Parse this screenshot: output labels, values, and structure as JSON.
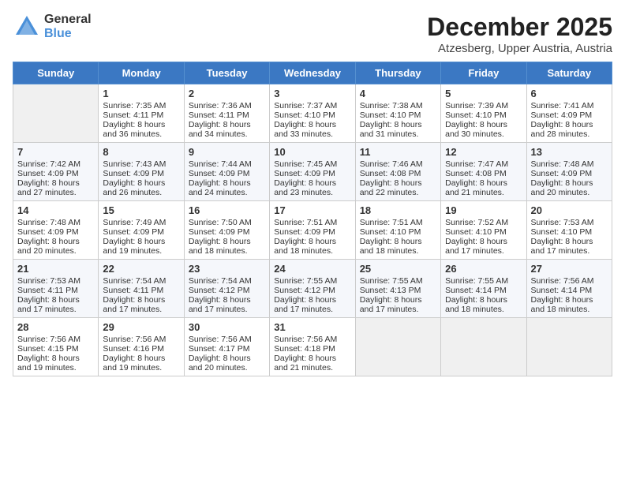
{
  "logo": {
    "general": "General",
    "blue": "Blue"
  },
  "header": {
    "month": "December 2025",
    "location": "Atzesberg, Upper Austria, Austria"
  },
  "weekdays": [
    "Sunday",
    "Monday",
    "Tuesday",
    "Wednesday",
    "Thursday",
    "Friday",
    "Saturday"
  ],
  "weeks": [
    [
      {
        "day": "",
        "info": ""
      },
      {
        "day": "1",
        "info": "Sunrise: 7:35 AM\nSunset: 4:11 PM\nDaylight: 8 hours\nand 36 minutes."
      },
      {
        "day": "2",
        "info": "Sunrise: 7:36 AM\nSunset: 4:11 PM\nDaylight: 8 hours\nand 34 minutes."
      },
      {
        "day": "3",
        "info": "Sunrise: 7:37 AM\nSunset: 4:10 PM\nDaylight: 8 hours\nand 33 minutes."
      },
      {
        "day": "4",
        "info": "Sunrise: 7:38 AM\nSunset: 4:10 PM\nDaylight: 8 hours\nand 31 minutes."
      },
      {
        "day": "5",
        "info": "Sunrise: 7:39 AM\nSunset: 4:10 PM\nDaylight: 8 hours\nand 30 minutes."
      },
      {
        "day": "6",
        "info": "Sunrise: 7:41 AM\nSunset: 4:09 PM\nDaylight: 8 hours\nand 28 minutes."
      }
    ],
    [
      {
        "day": "7",
        "info": "Sunrise: 7:42 AM\nSunset: 4:09 PM\nDaylight: 8 hours\nand 27 minutes."
      },
      {
        "day": "8",
        "info": "Sunrise: 7:43 AM\nSunset: 4:09 PM\nDaylight: 8 hours\nand 26 minutes."
      },
      {
        "day": "9",
        "info": "Sunrise: 7:44 AM\nSunset: 4:09 PM\nDaylight: 8 hours\nand 24 minutes."
      },
      {
        "day": "10",
        "info": "Sunrise: 7:45 AM\nSunset: 4:09 PM\nDaylight: 8 hours\nand 23 minutes."
      },
      {
        "day": "11",
        "info": "Sunrise: 7:46 AM\nSunset: 4:08 PM\nDaylight: 8 hours\nand 22 minutes."
      },
      {
        "day": "12",
        "info": "Sunrise: 7:47 AM\nSunset: 4:08 PM\nDaylight: 8 hours\nand 21 minutes."
      },
      {
        "day": "13",
        "info": "Sunrise: 7:48 AM\nSunset: 4:09 PM\nDaylight: 8 hours\nand 20 minutes."
      }
    ],
    [
      {
        "day": "14",
        "info": "Sunrise: 7:48 AM\nSunset: 4:09 PM\nDaylight: 8 hours\nand 20 minutes."
      },
      {
        "day": "15",
        "info": "Sunrise: 7:49 AM\nSunset: 4:09 PM\nDaylight: 8 hours\nand 19 minutes."
      },
      {
        "day": "16",
        "info": "Sunrise: 7:50 AM\nSunset: 4:09 PM\nDaylight: 8 hours\nand 18 minutes."
      },
      {
        "day": "17",
        "info": "Sunrise: 7:51 AM\nSunset: 4:09 PM\nDaylight: 8 hours\nand 18 minutes."
      },
      {
        "day": "18",
        "info": "Sunrise: 7:51 AM\nSunset: 4:10 PM\nDaylight: 8 hours\nand 18 minutes."
      },
      {
        "day": "19",
        "info": "Sunrise: 7:52 AM\nSunset: 4:10 PM\nDaylight: 8 hours\nand 17 minutes."
      },
      {
        "day": "20",
        "info": "Sunrise: 7:53 AM\nSunset: 4:10 PM\nDaylight: 8 hours\nand 17 minutes."
      }
    ],
    [
      {
        "day": "21",
        "info": "Sunrise: 7:53 AM\nSunset: 4:11 PM\nDaylight: 8 hours\nand 17 minutes."
      },
      {
        "day": "22",
        "info": "Sunrise: 7:54 AM\nSunset: 4:11 PM\nDaylight: 8 hours\nand 17 minutes."
      },
      {
        "day": "23",
        "info": "Sunrise: 7:54 AM\nSunset: 4:12 PM\nDaylight: 8 hours\nand 17 minutes."
      },
      {
        "day": "24",
        "info": "Sunrise: 7:55 AM\nSunset: 4:12 PM\nDaylight: 8 hours\nand 17 minutes."
      },
      {
        "day": "25",
        "info": "Sunrise: 7:55 AM\nSunset: 4:13 PM\nDaylight: 8 hours\nand 17 minutes."
      },
      {
        "day": "26",
        "info": "Sunrise: 7:55 AM\nSunset: 4:14 PM\nDaylight: 8 hours\nand 18 minutes."
      },
      {
        "day": "27",
        "info": "Sunrise: 7:56 AM\nSunset: 4:14 PM\nDaylight: 8 hours\nand 18 minutes."
      }
    ],
    [
      {
        "day": "28",
        "info": "Sunrise: 7:56 AM\nSunset: 4:15 PM\nDaylight: 8 hours\nand 19 minutes."
      },
      {
        "day": "29",
        "info": "Sunrise: 7:56 AM\nSunset: 4:16 PM\nDaylight: 8 hours\nand 19 minutes."
      },
      {
        "day": "30",
        "info": "Sunrise: 7:56 AM\nSunset: 4:17 PM\nDaylight: 8 hours\nand 20 minutes."
      },
      {
        "day": "31",
        "info": "Sunrise: 7:56 AM\nSunset: 4:18 PM\nDaylight: 8 hours\nand 21 minutes."
      },
      {
        "day": "",
        "info": ""
      },
      {
        "day": "",
        "info": ""
      },
      {
        "day": "",
        "info": ""
      }
    ]
  ]
}
